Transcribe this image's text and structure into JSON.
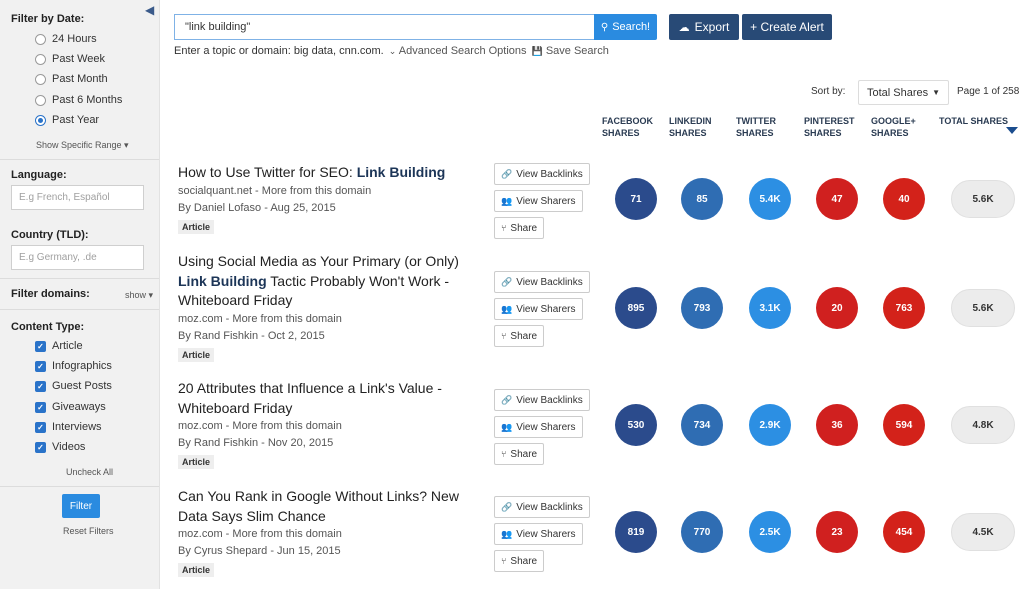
{
  "sidebar": {
    "date_heading": "Filter by Date:",
    "date_options": [
      {
        "label": "24 Hours",
        "checked": false
      },
      {
        "label": "Past Week",
        "checked": false
      },
      {
        "label": "Past Month",
        "checked": false
      },
      {
        "label": "Past 6 Months",
        "checked": false
      },
      {
        "label": "Past Year",
        "checked": true
      }
    ],
    "specific_range": "Show Specific Range ▾",
    "language_heading": "Language:",
    "language_placeholder": "E.g French, Español",
    "country_heading": "Country (TLD):",
    "country_placeholder": "E.g Germany, .de",
    "domains_heading": "Filter domains:",
    "domains_show": "show ▾",
    "content_heading": "Content Type:",
    "content_types": [
      {
        "label": "Article",
        "checked": true
      },
      {
        "label": "Infographics",
        "checked": true
      },
      {
        "label": "Guest Posts",
        "checked": true
      },
      {
        "label": "Giveaways",
        "checked": true
      },
      {
        "label": "Interviews",
        "checked": true
      },
      {
        "label": "Videos",
        "checked": true
      }
    ],
    "uncheck_all": "Uncheck All",
    "filter_label": "Filter",
    "reset_label": "Reset Filters"
  },
  "search": {
    "value": "\"link building\"",
    "button_label": "Search!",
    "hint": "Enter a topic or domain: big data, cnn.com.",
    "advanced": "Advanced Search Options",
    "save": "Save Search"
  },
  "toolbar": {
    "export_label": "Export",
    "alert_label": "+ Create Alert"
  },
  "sort": {
    "label": "Sort by:",
    "selected": "Total Shares",
    "page_info": "Page 1 of 258"
  },
  "columns": {
    "facebook": [
      "FACEBOOK",
      "SHARES"
    ],
    "linkedin": [
      "LINKEDIN",
      "SHARES"
    ],
    "twitter": [
      "TWITTER",
      "SHARES"
    ],
    "pinterest": [
      "PINTEREST",
      "SHARES"
    ],
    "google": [
      "GOOGLE+",
      "SHARES"
    ],
    "total": [
      "TOTAL SHARES"
    ]
  },
  "actions": {
    "backlinks": "View Backlinks",
    "sharers": "View Sharers",
    "share": "Share"
  },
  "more_from": "More from this domain",
  "colors": {
    "facebook": "#2b4b8c",
    "linkedin": "#2f6db3",
    "twitter": "#2c8fe3",
    "pinterest": "#d0201f",
    "google": "#d3221a"
  },
  "results": [
    {
      "title_lines": [
        [
          "How to Use Twitter for SEO: ",
          "Link Building"
        ]
      ],
      "domain": "socialquant.net",
      "byline": "By Daniel Lofaso - Aug 25, 2015",
      "tag": "Article",
      "facebook": "71",
      "linkedin": "85",
      "twitter": "5.4K",
      "pinterest": "47",
      "google": "40",
      "total": "5.6K"
    },
    {
      "title_lines": [
        [
          "Using Social Media as Your Primary (or Only)",
          ""
        ],
        [
          "",
          "Link Building"
        ],
        [
          " Tactic Probably Won't Work -",
          ""
        ],
        [
          "Whiteboard Friday",
          ""
        ]
      ],
      "domain": "moz.com",
      "byline": "By Rand Fishkin - Oct 2, 2015",
      "tag": "Article",
      "facebook": "895",
      "linkedin": "793",
      "twitter": "3.1K",
      "pinterest": "20",
      "google": "763",
      "total": "5.6K"
    },
    {
      "title_lines": [
        [
          "20 Attributes that Influence a Link's Value -",
          ""
        ],
        [
          "Whiteboard Friday",
          ""
        ]
      ],
      "domain": "moz.com",
      "byline": "By Rand Fishkin - Nov 20, 2015",
      "tag": "Article",
      "facebook": "530",
      "linkedin": "734",
      "twitter": "2.9K",
      "pinterest": "36",
      "google": "594",
      "total": "4.8K"
    },
    {
      "title_lines": [
        [
          "Can You Rank in Google Without Links? New",
          ""
        ],
        [
          "Data Says Slim Chance",
          ""
        ]
      ],
      "domain": "moz.com",
      "byline": "By Cyrus Shepard - Jun 15, 2015",
      "tag": "Article",
      "facebook": "819",
      "linkedin": "770",
      "twitter": "2.5K",
      "pinterest": "23",
      "google": "454",
      "total": "4.5K"
    }
  ]
}
